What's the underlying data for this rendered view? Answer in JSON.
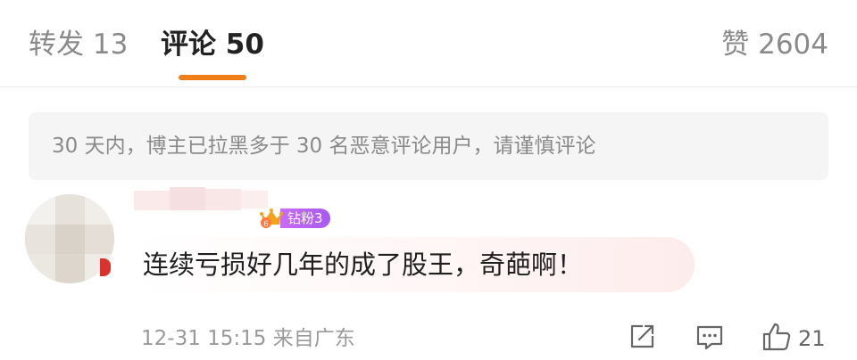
{
  "tabs": {
    "repost": "转发 13",
    "comments": "评论 50",
    "likes": "赞 2604"
  },
  "notice": "30 天内，博主已拉黑多于 30 名恶意评论用户，请谨慎评论",
  "comment": {
    "fan_badge": "钻粉3",
    "text": "连续亏损好几年的成了股王，奇葩啊！",
    "meta": "12-31 15:15 来自广东",
    "like_count": "21"
  },
  "icons": {
    "share": "edit-share-icon",
    "reply": "comment-icon",
    "like": "thumbs-up-icon",
    "badge": "crown-icon"
  },
  "colors": {
    "accent": "#ee7d1a",
    "badge_purple": "#b562f2"
  }
}
